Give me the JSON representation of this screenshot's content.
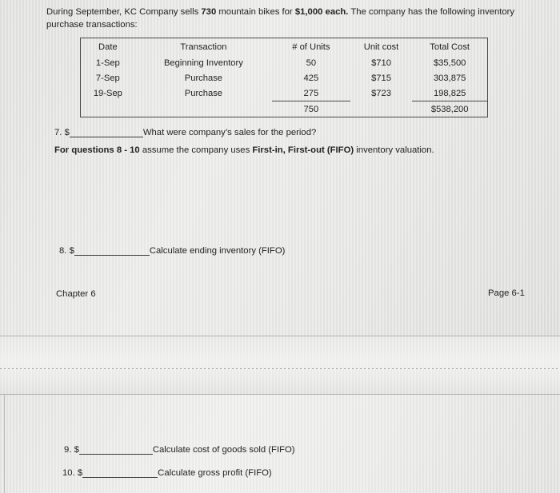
{
  "document": {
    "intro_part1": "During September, KC Company sells ",
    "intro_units": "730",
    "intro_part2": " mountain bikes for ",
    "intro_price": "$1,000 each.",
    "intro_part3": "  The company has the following inventory purchase transactions:"
  },
  "table": {
    "headers": [
      "Date",
      "Transaction",
      "# of Units",
      "Unit cost",
      "Total Cost"
    ],
    "rows": [
      {
        "date": "1-Sep",
        "transaction": "Beginning Inventory",
        "units": "50",
        "unit_cost": "$710",
        "total_cost": "$35,500"
      },
      {
        "date": "7-Sep",
        "transaction": "Purchase",
        "units": "425",
        "unit_cost": "$715",
        "total_cost": "303,875"
      },
      {
        "date": "19-Sep",
        "transaction": "Purchase",
        "units": "275",
        "unit_cost": "$723",
        "total_cost": "198,825"
      }
    ],
    "totals": {
      "date": "",
      "transaction": "",
      "units": "750",
      "unit_cost": "",
      "total_cost": "$538,200"
    }
  },
  "questions": {
    "q7": {
      "number": "7.",
      "currency": "$",
      "text": "What were company’s sales for the period?"
    },
    "note": {
      "lead": "For questions 8 - 10",
      "mid": " assume the company uses ",
      "bold_term": "First-in, First-out (FIFO)",
      "tail": " inventory valuation."
    },
    "q8": {
      "number": "8.",
      "currency": "$",
      "text": "Calculate ending inventory (FIFO)"
    },
    "q9": {
      "number": "9.",
      "currency": "$",
      "text": "Calculate cost of goods sold (FIFO)"
    },
    "q10": {
      "number": "10.",
      "currency": "$",
      "text": "Calculate gross profit (FIFO)"
    }
  },
  "footer": {
    "chapter": "Chapter 6",
    "page": "Page 6-1"
  }
}
